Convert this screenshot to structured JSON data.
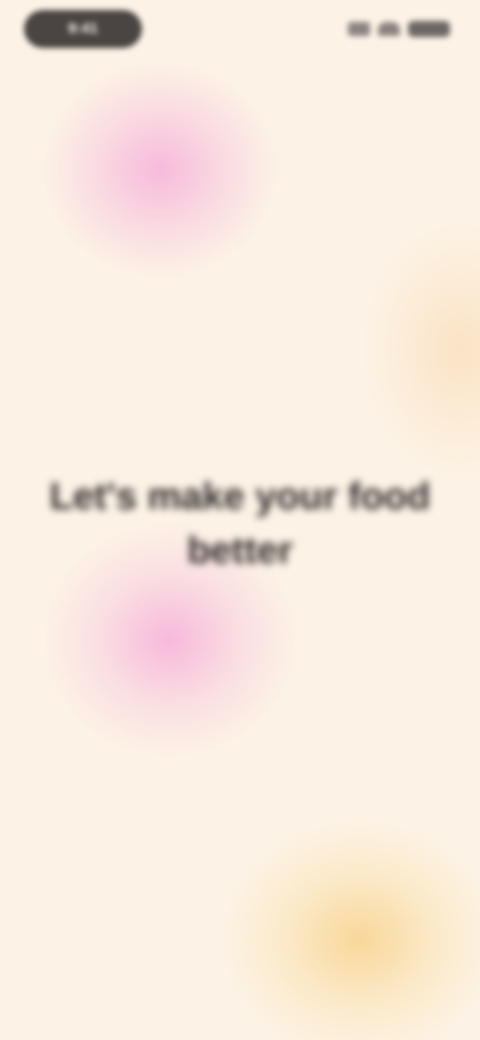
{
  "status_bar": {
    "time": "9:41"
  },
  "main": {
    "headline": "Let's make your food better"
  },
  "colors": {
    "background": "#fcf3e6",
    "pink_blob": "#f6b0da",
    "yellow_blob": "#f8d28c",
    "text": "#2f2a29"
  }
}
